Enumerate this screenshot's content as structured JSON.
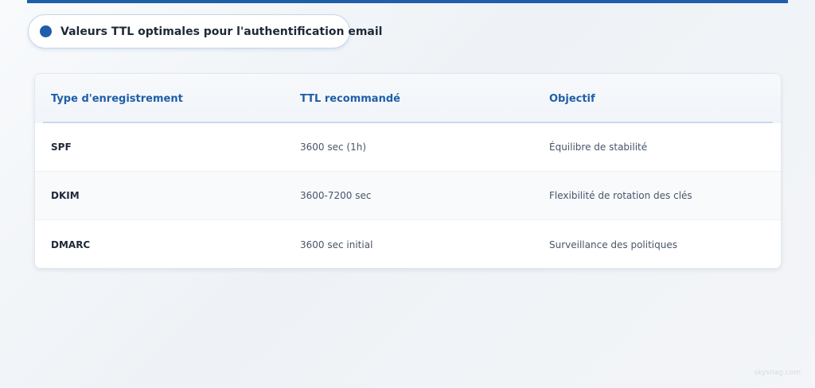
{
  "title": "Valeurs TTL optimales pour l'authentification email",
  "table": {
    "headers": [
      "Type d'enregistrement",
      "TTL recommandé",
      "Objectif"
    ],
    "rows": [
      {
        "type": "SPF",
        "ttl": "3600 sec (1h)",
        "purpose": "Équilibre de stabilité"
      },
      {
        "type": "DKIM",
        "ttl": "3600-7200 sec",
        "purpose": "Flexibilité de rotation des clés"
      },
      {
        "type": "DMARC",
        "ttl": "3600 sec initial",
        "purpose": "Surveillance des politiques"
      }
    ]
  },
  "watermark": "skysnag.com",
  "colors": {
    "accent": "#1f5ea8",
    "heading_text": "#1f2937",
    "body_text": "#475569"
  }
}
